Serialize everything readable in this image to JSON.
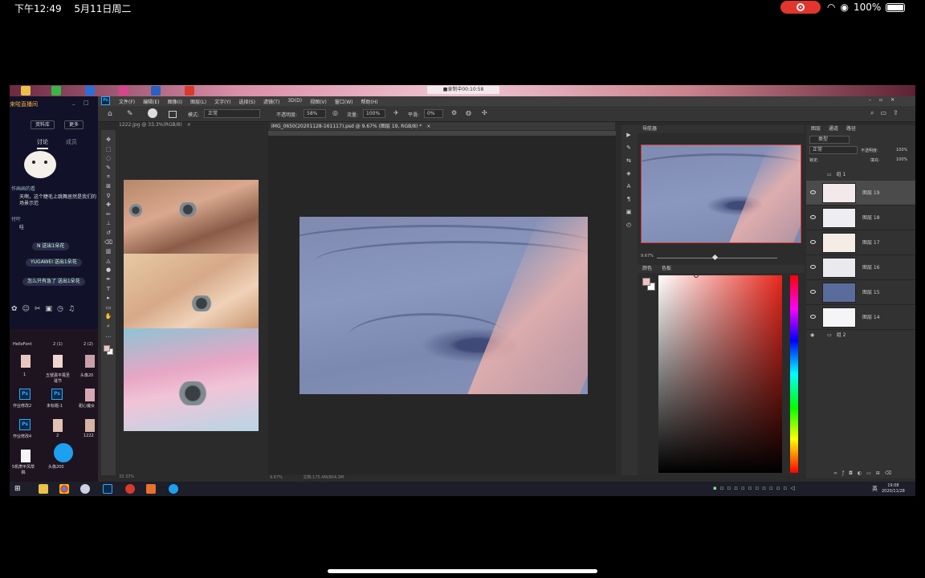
{
  "ios_status": {
    "time": "下午12:49",
    "date": "5月11日周二",
    "battery": "100%"
  },
  "wallpaper": {
    "caption": "■录制中00:10:58"
  },
  "chat": {
    "title": "来啦直播间",
    "buttons": [
      "资料库",
      "更多"
    ],
    "tabs": [
      "讨论",
      "成员"
    ],
    "messages": [
      {
        "user": "作画画的看",
        "text": "天啊，这个睫毛上跳舞居然是我们的场景示范"
      },
      {
        "user": "付叶",
        "text": "哇"
      }
    ],
    "gifts": [
      "N 送出1朵花",
      "YUGAWEI 送出1朵花",
      "怎么只有急了 送出1朵花"
    ]
  },
  "desktop": {
    "header_left": "HelloFont",
    "header_mid": "2 (1)",
    "header_right": "2 (2)",
    "icons": [
      {
        "label": "1"
      },
      {
        "label": "五號肅平風圣诞节"
      },
      {
        "label": "头像20"
      },
      {
        "label": "作业修改2"
      },
      {
        "label": "未标题-1"
      },
      {
        "label": "甜心魔女"
      },
      {
        "label": "作业修改4"
      },
      {
        "label": "2"
      },
      {
        "label": "1222"
      },
      {
        "label": "5帆肃平风草稿"
      },
      {
        "label": "头像200"
      }
    ]
  },
  "ps": {
    "menu": [
      "文件(F)",
      "编辑(E)",
      "图像(I)",
      "图层(L)",
      "文字(Y)",
      "选择(S)",
      "滤镜(T)",
      "3D(D)",
      "视图(V)",
      "窗口(W)",
      "帮助(H)"
    ],
    "options": {
      "mode_label": "模式:",
      "mode_value": "正常",
      "opacity_label": "不透明度:",
      "opacity_value": "58%",
      "flow_label": "流量:",
      "flow_value": "100%",
      "smooth_label": "平滑:",
      "smooth_value": "0%"
    },
    "tabs": {
      "ref": "1222.jpg @ 33.3%(RGB/8)",
      "main": "IMG_0650(20201128-161117).psd @ 9.67% (图层 19, RGB/8) *"
    },
    "status": {
      "ref_zoom": "33.33%",
      "main_zoom": "9.67%",
      "doc_size": "文档:175.4M/804.3M"
    },
    "navigator": {
      "title": "导航器",
      "zoom": "9.67%"
    },
    "color": {
      "tabs": [
        "颜色",
        "色板"
      ],
      "fg": "#f1c2bf",
      "bg": "#ffffff"
    },
    "layers": {
      "tabs": [
        "图层",
        "通道",
        "路径"
      ],
      "filter": "类型",
      "blend": "正常",
      "opacity_label": "不透明度:",
      "opacity": "100%",
      "lock_label": "锁定:",
      "fill_label": "填充:",
      "fill": "100%",
      "group_top": "组 1",
      "group_bottom": "组 2",
      "items": [
        {
          "name": "图层 19",
          "thumb": "#f4e9ea"
        },
        {
          "name": "图层 18",
          "thumb": "#eeeef2"
        },
        {
          "name": "图层 17",
          "thumb": "#f6ece6"
        },
        {
          "name": "图层 16",
          "thumb": "#e9e9ee"
        },
        {
          "name": "图层 15",
          "thumb": "#5a6c9c"
        },
        {
          "name": "图层 14",
          "thumb": "#f5f5f7"
        }
      ]
    }
  },
  "taskbar": {
    "time": "19:08",
    "date": "2020/11/28",
    "lang": "英"
  }
}
